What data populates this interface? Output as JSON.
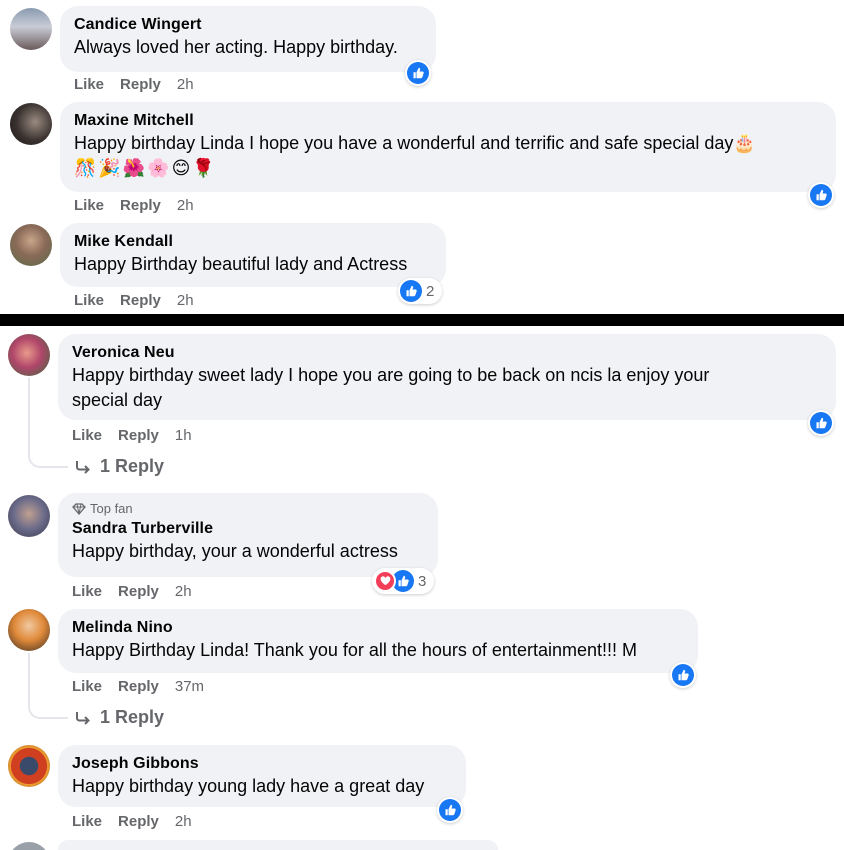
{
  "comments": [
    {
      "author": "Candice Wingert",
      "text": "Always loved her acting. Happy birthday.",
      "like": "Like",
      "reply": "Reply",
      "time": "2h",
      "reaction_count": ""
    },
    {
      "author": "Maxine Mitchell",
      "text": "Happy birthday Linda I hope you have a wonderful and terrific and safe special day🎂",
      "emojis": "🎊🎉🌺🌸😊🌹",
      "like": "Like",
      "reply": "Reply",
      "time": "2h",
      "reaction_count": ""
    },
    {
      "author": "Mike Kendall",
      "text": "Happy Birthday beautiful lady and Actress",
      "like": "Like",
      "reply": "Reply",
      "time": "2h",
      "reaction_count": "2"
    },
    {
      "author": "Veronica Neu",
      "text_line1": "Happy birthday sweet lady I hope you are going to be back on ncis la enjoy your",
      "text_line2": "special day",
      "like": "Like",
      "reply": "Reply",
      "time": "1h",
      "replies_link": "1 Reply",
      "reaction_count": ""
    },
    {
      "badge": "Top fan",
      "author": "Sandra Turberville",
      "text": "Happy birthday, your a wonderful actress",
      "like": "Like",
      "reply": "Reply",
      "time": "2h",
      "reaction_count": "3"
    },
    {
      "author": "Melinda Nino",
      "text": "Happy Birthday Linda! Thank you for all the hours of entertainment!!! M",
      "like": "Like",
      "reply": "Reply",
      "time": "37m",
      "replies_link": "1 Reply",
      "reaction_count": ""
    },
    {
      "author": "Joseph Gibbons",
      "text": "Happy birthday young lady have a great day",
      "like": "Like",
      "reply": "Reply",
      "time": "2h",
      "reaction_count": ""
    }
  ],
  "colors": {
    "like_blue": "#1877f2",
    "love_red": "#f33e58",
    "bubble_bg": "#f0f2f5",
    "meta_gray": "#65676b"
  },
  "icons": [
    "like-icon",
    "love-icon",
    "reply-arrow-icon",
    "top-fan-diamond-icon"
  ]
}
